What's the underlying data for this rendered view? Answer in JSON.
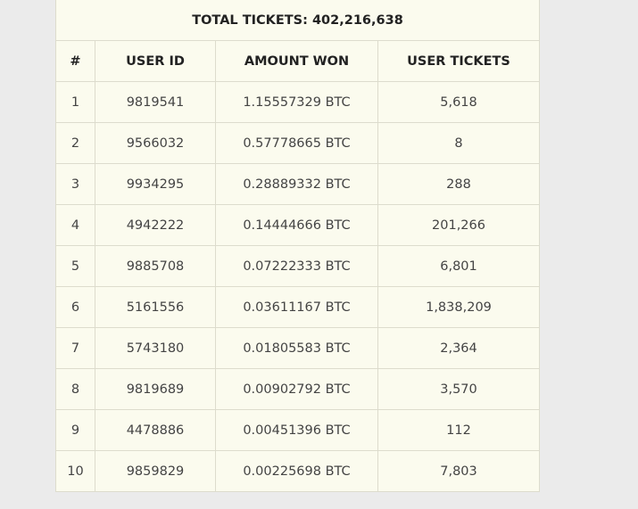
{
  "table": {
    "total_label": "TOTAL TICKETS: 402,216,638",
    "headers": {
      "rank": "#",
      "user_id": "USER ID",
      "amount_won": "AMOUNT WON",
      "user_tickets": "USER TICKETS"
    },
    "rows": [
      {
        "rank": "1",
        "user_id": "9819541",
        "amount": "1.15557329 BTC",
        "tickets": "5,618"
      },
      {
        "rank": "2",
        "user_id": "9566032",
        "amount": "0.57778665 BTC",
        "tickets": "8"
      },
      {
        "rank": "3",
        "user_id": "9934295",
        "amount": "0.28889332 BTC",
        "tickets": "288"
      },
      {
        "rank": "4",
        "user_id": "4942222",
        "amount": "0.14444666 BTC",
        "tickets": "201,266"
      },
      {
        "rank": "5",
        "user_id": "9885708",
        "amount": "0.07222333 BTC",
        "tickets": "6,801"
      },
      {
        "rank": "6",
        "user_id": "5161556",
        "amount": "0.03611167 BTC",
        "tickets": "1,838,209"
      },
      {
        "rank": "7",
        "user_id": "5743180",
        "amount": "0.01805583 BTC",
        "tickets": "2,364"
      },
      {
        "rank": "8",
        "user_id": "9819689",
        "amount": "0.00902792 BTC",
        "tickets": "3,570"
      },
      {
        "rank": "9",
        "user_id": "4478886",
        "amount": "0.00451396 BTC",
        "tickets": "112"
      },
      {
        "rank": "10",
        "user_id": "9859829",
        "amount": "0.00225698 BTC",
        "tickets": "7,803"
      }
    ]
  },
  "colors": {
    "page_background": "#ebebeb",
    "table_background": "#fbfbee",
    "border": "#dddccd",
    "top_rule": "#3a6fb0"
  }
}
